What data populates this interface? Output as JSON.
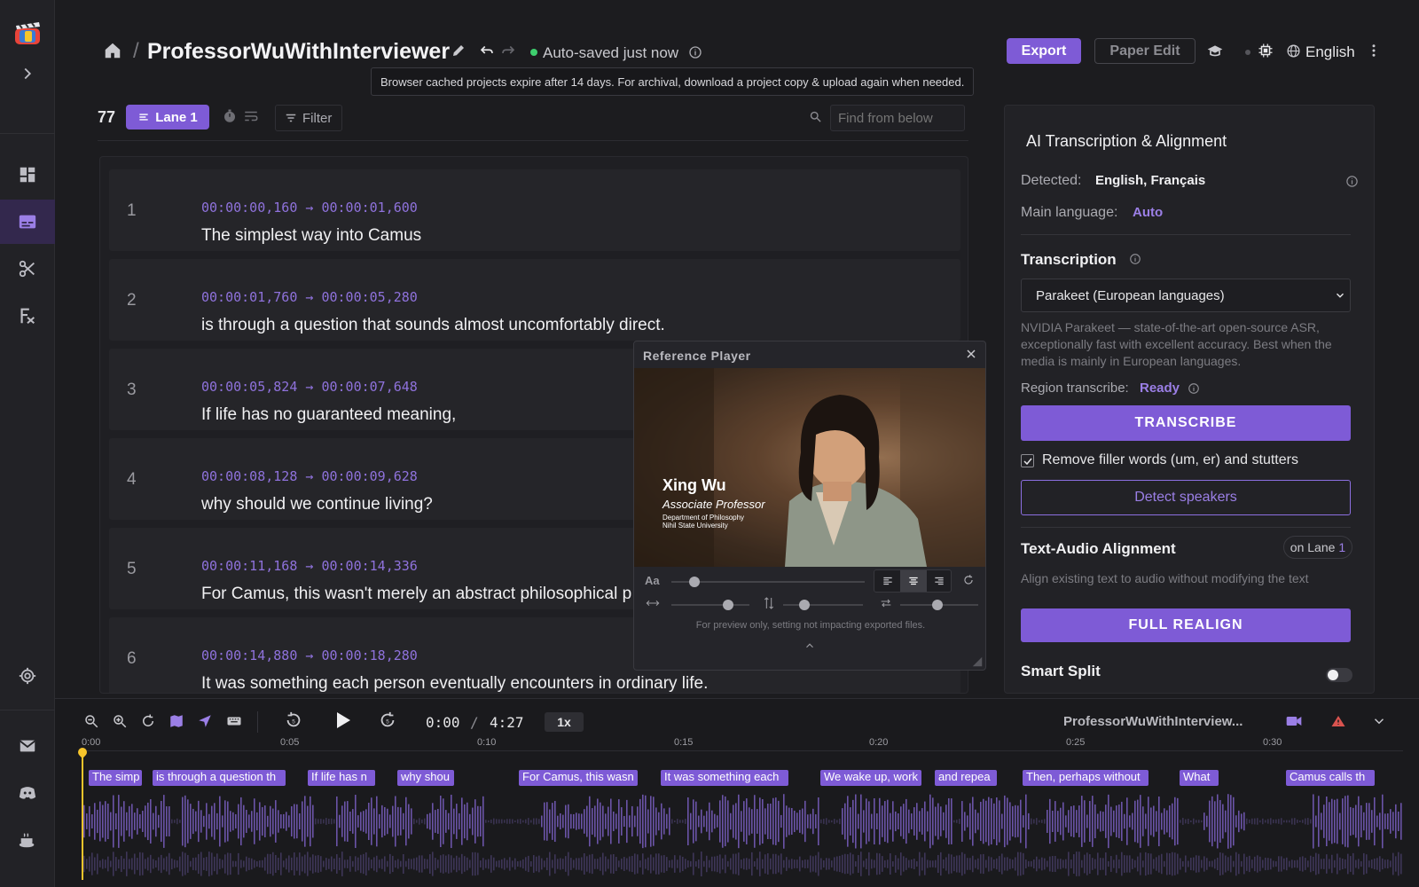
{
  "header": {
    "title": "ProfessorWuWithInterviewer",
    "autosave": "Auto-saved just now",
    "export_label": "Export",
    "paper_edit_label": "Paper Edit",
    "language": "English",
    "tooltip": "Browser cached projects expire after 14 days. For archival, download a project copy & upload again when needed."
  },
  "toolbar": {
    "count": "77",
    "lane_label": "Lane 1",
    "filter_label": "Filter",
    "search_placeholder": "Find from below"
  },
  "segments": [
    {
      "num": "1",
      "time": "00:00:00,160 → 00:00:01,600",
      "text": "The simplest way into Camus"
    },
    {
      "num": "2",
      "time": "00:00:01,760 → 00:00:05,280",
      "text": "is through a question that sounds almost uncomfortably direct."
    },
    {
      "num": "3",
      "time": "00:00:05,824 → 00:00:07,648",
      "text": "If life has no guaranteed meaning,"
    },
    {
      "num": "4",
      "time": "00:00:08,128 → 00:00:09,628",
      "text": "why should we continue living?"
    },
    {
      "num": "5",
      "time": "00:00:11,168 → 00:00:14,336",
      "text": "For Camus, this wasn't merely an abstract philosophical p"
    },
    {
      "num": "6",
      "time": "00:00:14,880 → 00:00:18,280",
      "text": "It was something each person eventually encounters in ordinary life."
    }
  ],
  "player": {
    "title": "Reference Player",
    "name": "Xing Wu",
    "role": "Associate Professor",
    "dept": "Department of Philosophy",
    "univ": "Nihil State University",
    "font_label": "Aa",
    "note": "For preview only, setting not impacting exported files."
  },
  "panel": {
    "title": "AI Transcription & Alignment",
    "detected_label": "Detected:",
    "detected_value": "English, Français",
    "main_lang_label": "Main language:",
    "main_lang_value": "Auto",
    "transcription_label": "Transcription",
    "model_selected": "Parakeet (European languages)",
    "model_desc_1": "NVIDIA Parakeet — state-of-the-art open-source ASR,",
    "model_desc_2": "exceptionally fast with excellent accuracy. Best when the",
    "model_desc_3": "media is mainly in European languages.",
    "region_label": "Region transcribe:",
    "region_value": "Ready",
    "transcribe_label": "TRANSCRIBE",
    "filler_label": "Remove filler words (um, er) and stutters",
    "detect_speakers_label": "Detect speakers",
    "alignment_label": "Text-Audio Alignment",
    "alignment_lane_prefix": "on Lane",
    "alignment_lane_num": "1",
    "alignment_desc": "Align existing text to audio without modifying the text",
    "full_realign_label": "FULL REALIGN",
    "smart_split_label": "Smart Split"
  },
  "timeline": {
    "current": "0:00",
    "separator": "/",
    "total": "4:27",
    "speed": "1x",
    "project": "ProfessorWuWithInterview...",
    "ruler": [
      "0:00",
      "0:05",
      "0:10",
      "0:15",
      "0:20",
      "0:25",
      "0:30"
    ],
    "clips": [
      "The simp",
      "is through a question th",
      "If life has n",
      "why shou",
      "For Camus, this wasn",
      "It was something each",
      "We wake up, work",
      "and repea",
      "Then, perhaps without",
      "What",
      "Camus calls th"
    ]
  },
  "colors": {
    "accent": "#7e5bd6",
    "accent_text": "#9b7fe6",
    "background": "#1c1c1f",
    "status_green": "#3ecf6e"
  }
}
